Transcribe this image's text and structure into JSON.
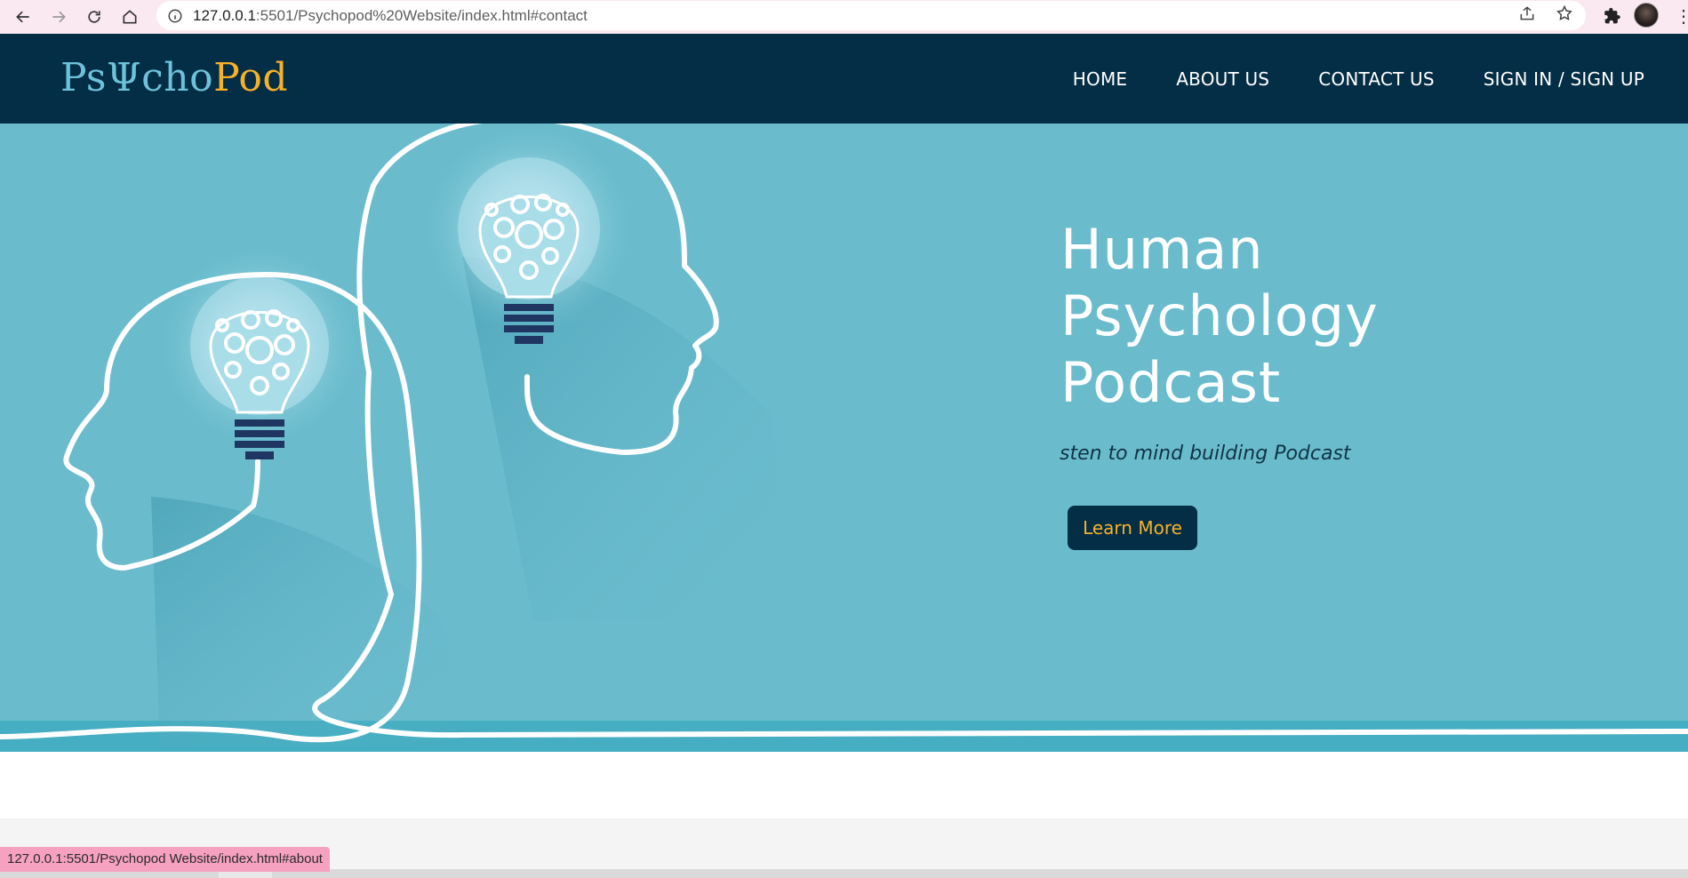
{
  "browser": {
    "url_host": "127.0.0.1",
    "url_rest": ":5501/Psychopod%20Website/index.html#contact",
    "status_url": "127.0.0.1:5501/Psychopod Website/index.html#about"
  },
  "site": {
    "logo_part1": "PsΨcho",
    "logo_part2": "Pod",
    "nav": [
      "HOME",
      "ABOUT US",
      "CONTACT US",
      "SIGN IN / SIGN UP"
    ]
  },
  "hero": {
    "title_line1": "Human",
    "title_line2": "Psychology",
    "title_line3": "Podcast",
    "subtitle": "sten to mind building Podcast",
    "button_label": "Learn More"
  },
  "colors": {
    "header_bg": "#042e45",
    "hero_bg": "#6abccd",
    "accent": "#f6b12b",
    "logo_blue": "#6ec1da"
  }
}
